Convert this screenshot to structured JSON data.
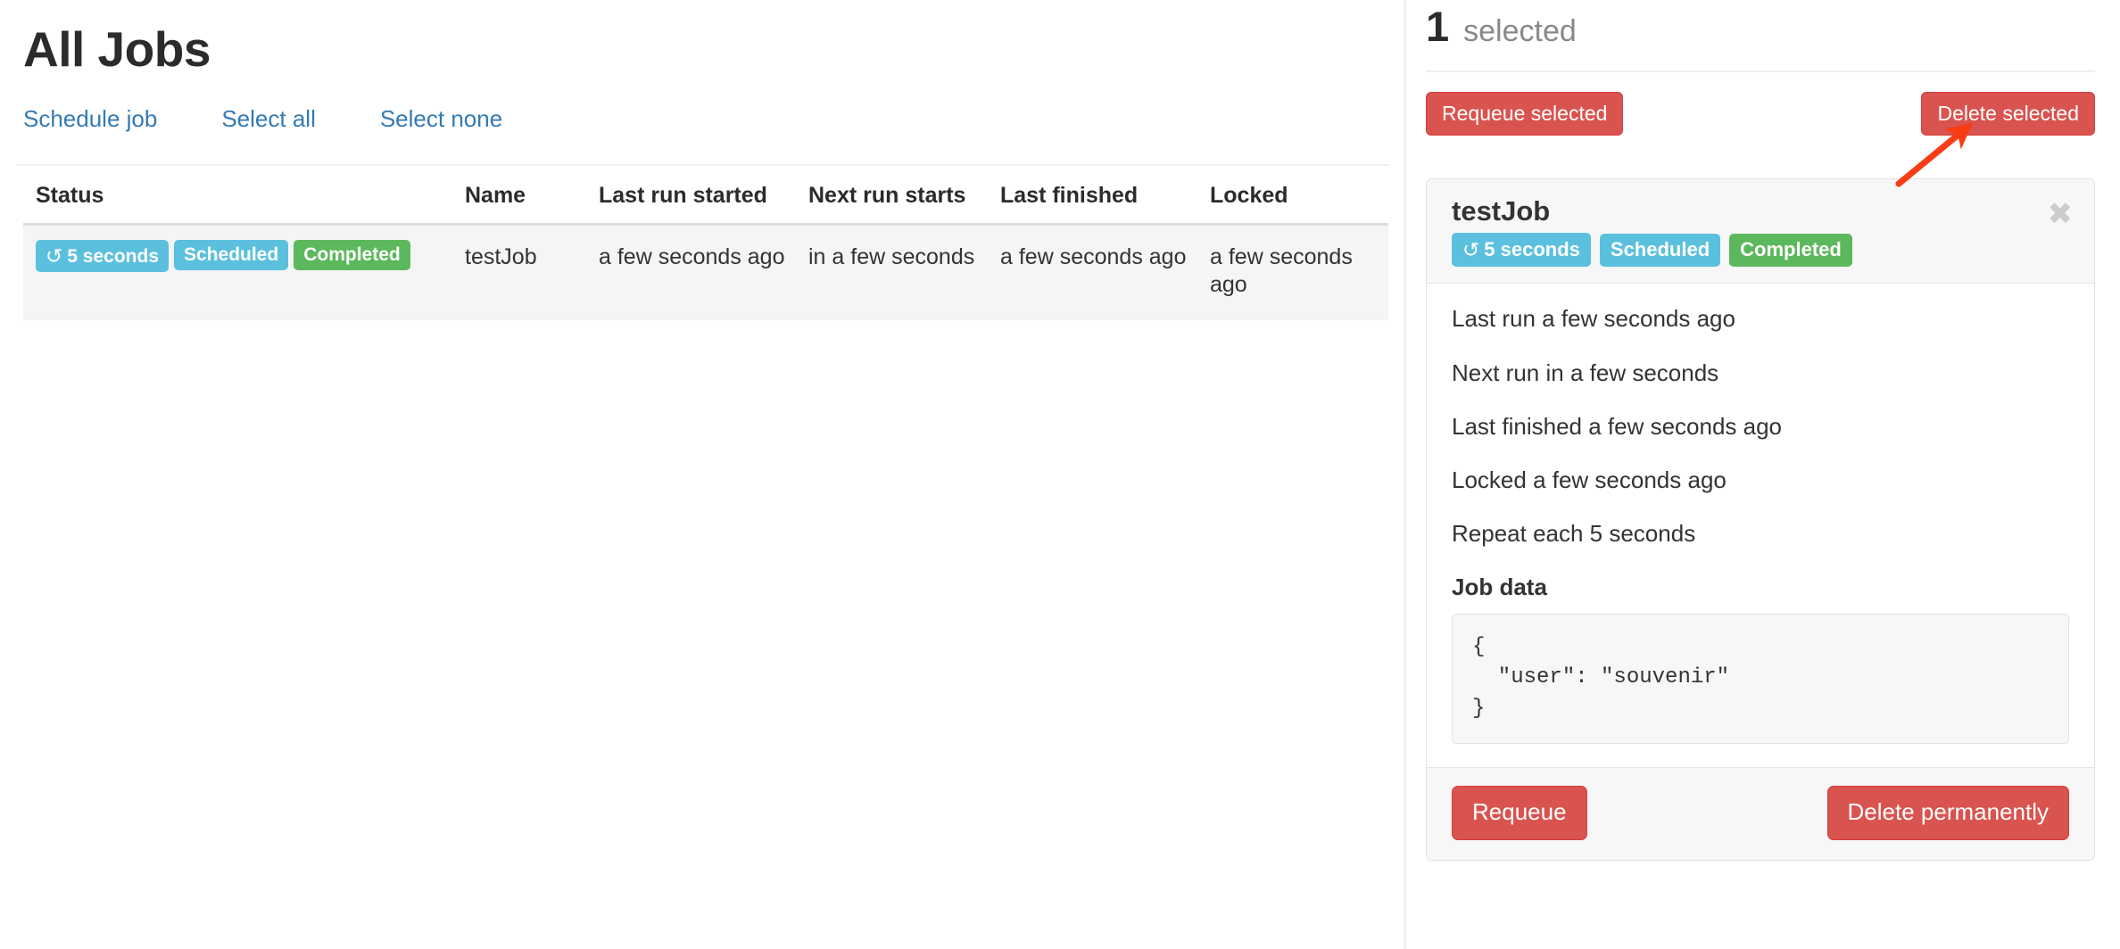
{
  "left": {
    "page_title": "All Jobs",
    "actions": [
      {
        "label": "Schedule job",
        "name": "schedule-job-link"
      },
      {
        "label": "Select all",
        "name": "select-all-link"
      },
      {
        "label": "Select none",
        "name": "select-none-link"
      }
    ],
    "table": {
      "columns": [
        "Status",
        "Name",
        "Last run started",
        "Next run starts",
        "Last finished",
        "Locked"
      ],
      "rows": [
        {
          "badges": [
            {
              "text": "5 seconds",
              "style": "info",
              "icon": "refresh-icon"
            },
            {
              "text": "Scheduled",
              "style": "info",
              "icon": null
            },
            {
              "text": "Completed",
              "style": "success",
              "icon": null
            }
          ],
          "name": "testJob",
          "last_run_started": "a few seconds ago",
          "next_run_starts": "in a few seconds",
          "last_finished": "a few seconds ago",
          "locked": "a few seconds ago"
        }
      ]
    }
  },
  "right": {
    "selected_count": "1",
    "selected_label": "selected",
    "requeue_selected_label": "Requeue selected",
    "delete_selected_label": "Delete selected",
    "card": {
      "title": "testJob",
      "badges": [
        {
          "text": "5 seconds",
          "style": "info",
          "icon": "refresh-icon"
        },
        {
          "text": "Scheduled",
          "style": "info",
          "icon": null
        },
        {
          "text": "Completed",
          "style": "success",
          "icon": null
        }
      ],
      "close_glyph": "✖",
      "details": [
        "Last run a few seconds ago",
        "Next run in a few seconds",
        "Last finished a few seconds ago",
        "Locked a few seconds ago",
        "Repeat each 5 seconds"
      ],
      "job_data_label": "Job data",
      "job_data_code": "{\n  \"user\": \"souvenir\"\n}",
      "requeue_label": "Requeue",
      "delete_permanently_label": "Delete permanently"
    }
  },
  "annotation": {
    "arrow_color": "#fa3c14",
    "points_to": "delete-selected-button"
  },
  "icons": {
    "refresh": "↻"
  },
  "colors": {
    "link": "#337ab7",
    "danger": "#d9534f",
    "info_badge": "#5bc0de",
    "success_badge": "#5cb85c",
    "row_background": "#f5f5f5"
  }
}
